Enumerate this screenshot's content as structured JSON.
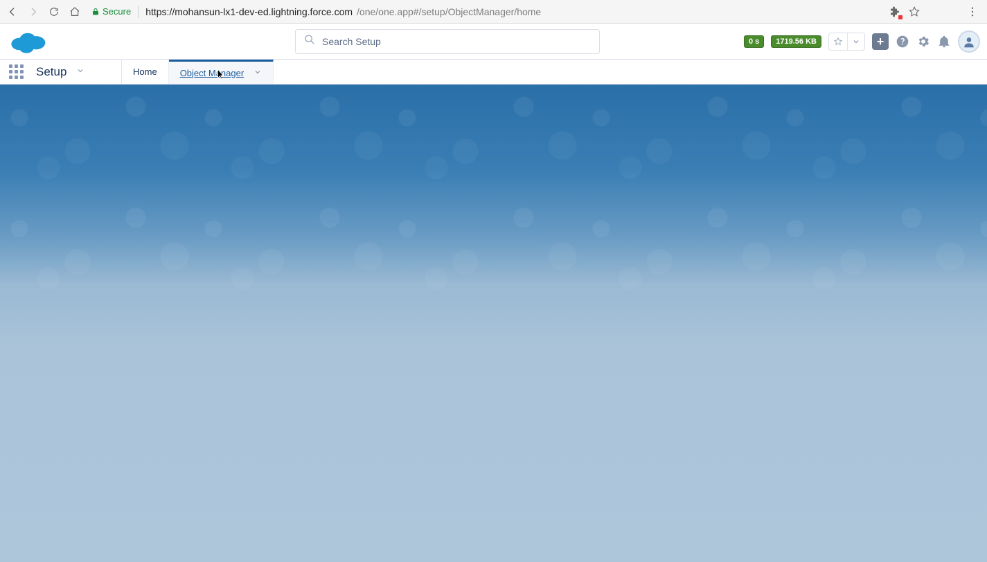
{
  "browser": {
    "secure_label": "Secure",
    "url_host": "https://mohansun-lx1-dev-ed.lightning.force.com",
    "url_path": "/one/one.app#/setup/ObjectManager/home"
  },
  "search": {
    "placeholder": "Search Setup"
  },
  "status": {
    "timer": "0 s",
    "memory": "1719.56 KB"
  },
  "app": {
    "name": "Setup"
  },
  "tabs": [
    {
      "label": "Home",
      "active": false,
      "has_dropdown": false
    },
    {
      "label": "Object Manager",
      "active": true,
      "has_dropdown": true
    }
  ]
}
